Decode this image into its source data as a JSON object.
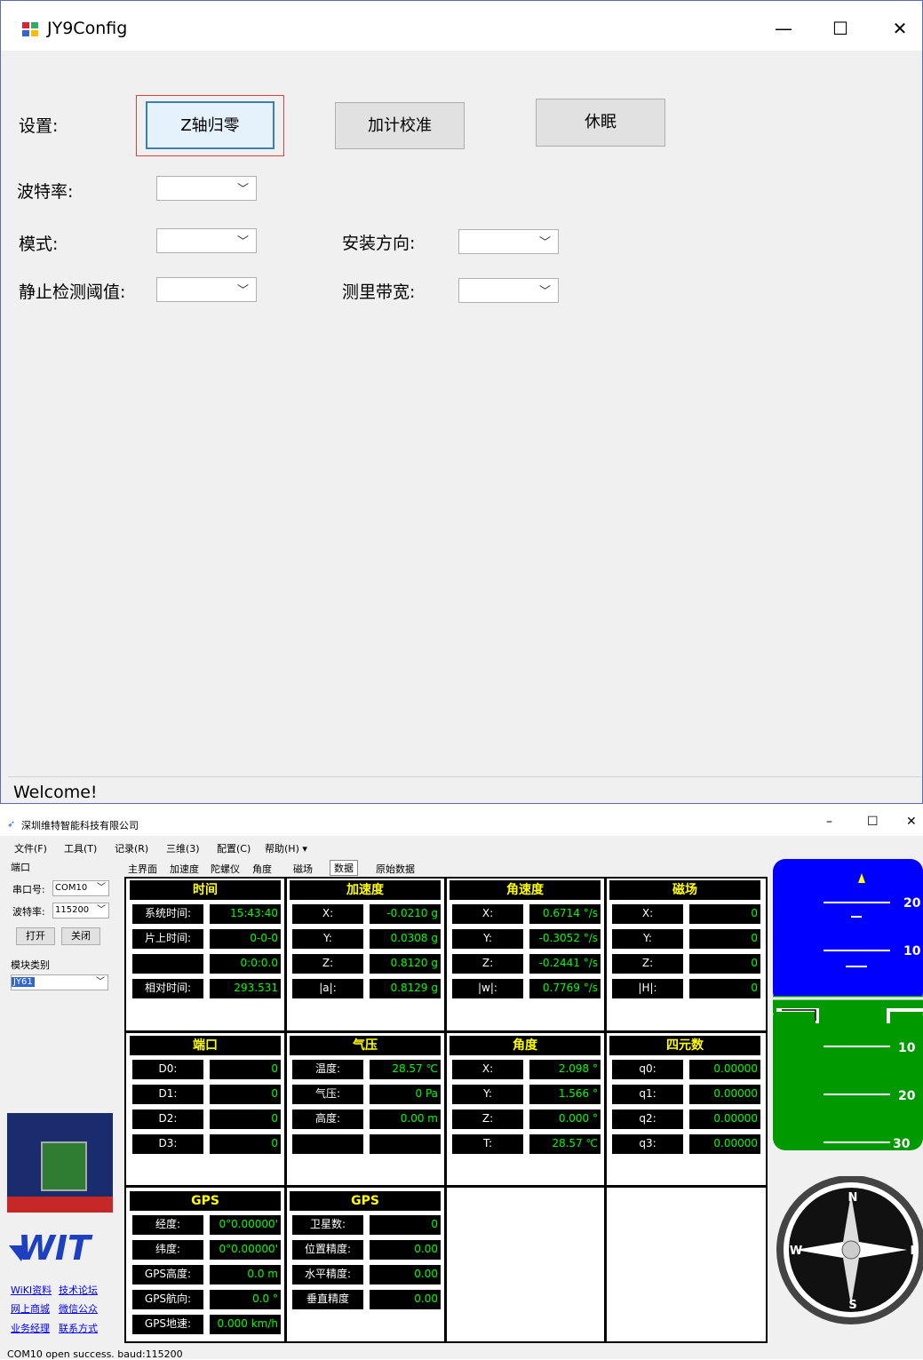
{
  "win1": {
    "title": "JY9Config",
    "setting_label": "设置:",
    "z_zero": "Z轴归零",
    "acc_cal": "加计校准",
    "sleep": "休眠",
    "baud_label": "波特率:",
    "mode_label": "模式:",
    "install_label": "安装方向:",
    "static_label": "静止检测阈值:",
    "bandwidth_label": "测里带宽:",
    "status": "Welcome!"
  },
  "win2": {
    "title": "深圳维特智能科技有限公司",
    "menus": [
      "文件(F)",
      "工具(T)",
      "记录(R)",
      "三维(3)",
      "配置(C)",
      "帮助(H) ▾"
    ],
    "port_group": "端口",
    "port_label": "串口号:",
    "port_value": "COM10",
    "baud_label": "波特率:",
    "baud_value": "115200",
    "open": "打开",
    "close": "关闭",
    "module_group": "模块类别",
    "module_value": "JY61",
    "tabs": [
      "主界面",
      "加速度",
      "陀螺仪",
      "角度",
      "磁场",
      "数据",
      "原始数据"
    ],
    "sections": {
      "time": "时间",
      "acc": "加速度",
      "gyro": "角速度",
      "mag": "磁场",
      "port": "端口",
      "pressure": "气压",
      "angle": "角度",
      "quat": "四元数",
      "gps1": "GPS",
      "gps2": "GPS"
    },
    "time": [
      [
        "系统时间:",
        "15:43:40"
      ],
      [
        "片上时间:",
        "0-0-0"
      ],
      [
        "",
        "0:0:0.0"
      ],
      [
        "相对时间:",
        "293.531"
      ]
    ],
    "acc": [
      [
        "X:",
        "-0.0210 g"
      ],
      [
        "Y:",
        "0.0308 g"
      ],
      [
        "Z:",
        "0.8120 g"
      ],
      [
        "|a|:",
        "0.8129 g"
      ]
    ],
    "gyro": [
      [
        "X:",
        "0.6714 °/s"
      ],
      [
        "Y:",
        "-0.3052 °/s"
      ],
      [
        "Z:",
        "-0.2441 °/s"
      ],
      [
        "|w|:",
        "0.7769 °/s"
      ]
    ],
    "mag": [
      [
        "X:",
        "0"
      ],
      [
        "Y:",
        "0"
      ],
      [
        "Z:",
        "0"
      ],
      [
        "|H|:",
        "0"
      ]
    ],
    "port": [
      [
        "D0:",
        "0"
      ],
      [
        "D1:",
        "0"
      ],
      [
        "D2:",
        "0"
      ],
      [
        "D3:",
        "0"
      ]
    ],
    "pressure": [
      [
        "温度:",
        "28.57 ℃"
      ],
      [
        "气压:",
        "0 Pa"
      ],
      [
        "高度:",
        "0.00 m"
      ],
      [
        "",
        ""
      ]
    ],
    "angle": [
      [
        "X:",
        "2.098 °"
      ],
      [
        "Y:",
        "1.566 °"
      ],
      [
        "Z:",
        "0.000 °"
      ],
      [
        "T:",
        "28.57 ℃"
      ]
    ],
    "quat": [
      [
        "q0:",
        "0.00000"
      ],
      [
        "q1:",
        "0.00000"
      ],
      [
        "q2:",
        "0.00000"
      ],
      [
        "q3:",
        "0.00000"
      ]
    ],
    "gps1": [
      [
        "经度:",
        "0°0.00000'"
      ],
      [
        "纬度:",
        "0°0.00000'"
      ],
      [
        "GPS高度:",
        "0.0 m"
      ],
      [
        "GPS航向:",
        "0.0 °"
      ],
      [
        "GPS地速:",
        "0.000 km/h"
      ]
    ],
    "gps2": [
      [
        "卫星数:",
        "0"
      ],
      [
        "位置精度:",
        "0.00"
      ],
      [
        "水平精度:",
        "0.00"
      ],
      [
        "垂直精度",
        "0.00"
      ]
    ],
    "links": [
      "WiKI资料",
      "技术论坛",
      "网上商城",
      "微信公众",
      "业务经理",
      "联系方式"
    ],
    "horizon_labels": [
      "20",
      "10",
      "10",
      "20",
      "30"
    ],
    "compass": [
      "N",
      "E",
      "S",
      "W"
    ],
    "status": "COM10 open success. baud:115200"
  }
}
